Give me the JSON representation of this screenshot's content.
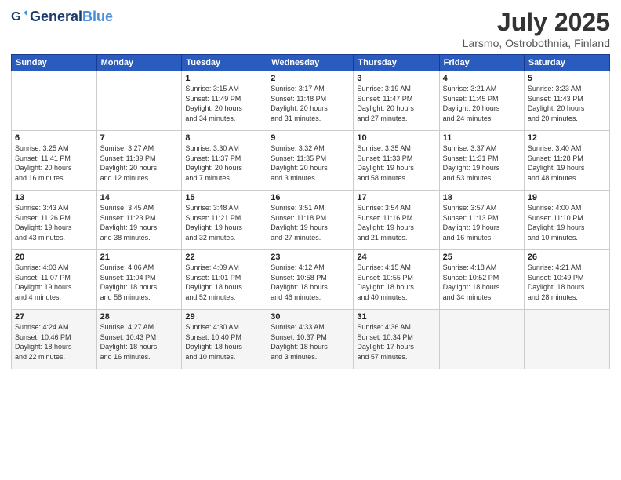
{
  "header": {
    "logo": {
      "general": "General",
      "blue": "Blue"
    },
    "title": "July 2025",
    "location": "Larsmo, Ostrobothnia, Finland"
  },
  "weekdays": [
    "Sunday",
    "Monday",
    "Tuesday",
    "Wednesday",
    "Thursday",
    "Friday",
    "Saturday"
  ],
  "weeks": [
    [
      {
        "day": "",
        "info": ""
      },
      {
        "day": "",
        "info": ""
      },
      {
        "day": "1",
        "info": "Sunrise: 3:15 AM\nSunset: 11:49 PM\nDaylight: 20 hours\nand 34 minutes."
      },
      {
        "day": "2",
        "info": "Sunrise: 3:17 AM\nSunset: 11:48 PM\nDaylight: 20 hours\nand 31 minutes."
      },
      {
        "day": "3",
        "info": "Sunrise: 3:19 AM\nSunset: 11:47 PM\nDaylight: 20 hours\nand 27 minutes."
      },
      {
        "day": "4",
        "info": "Sunrise: 3:21 AM\nSunset: 11:45 PM\nDaylight: 20 hours\nand 24 minutes."
      },
      {
        "day": "5",
        "info": "Sunrise: 3:23 AM\nSunset: 11:43 PM\nDaylight: 20 hours\nand 20 minutes."
      }
    ],
    [
      {
        "day": "6",
        "info": "Sunrise: 3:25 AM\nSunset: 11:41 PM\nDaylight: 20 hours\nand 16 minutes."
      },
      {
        "day": "7",
        "info": "Sunrise: 3:27 AM\nSunset: 11:39 PM\nDaylight: 20 hours\nand 12 minutes."
      },
      {
        "day": "8",
        "info": "Sunrise: 3:30 AM\nSunset: 11:37 PM\nDaylight: 20 hours\nand 7 minutes."
      },
      {
        "day": "9",
        "info": "Sunrise: 3:32 AM\nSunset: 11:35 PM\nDaylight: 20 hours\nand 3 minutes."
      },
      {
        "day": "10",
        "info": "Sunrise: 3:35 AM\nSunset: 11:33 PM\nDaylight: 19 hours\nand 58 minutes."
      },
      {
        "day": "11",
        "info": "Sunrise: 3:37 AM\nSunset: 11:31 PM\nDaylight: 19 hours\nand 53 minutes."
      },
      {
        "day": "12",
        "info": "Sunrise: 3:40 AM\nSunset: 11:28 PM\nDaylight: 19 hours\nand 48 minutes."
      }
    ],
    [
      {
        "day": "13",
        "info": "Sunrise: 3:43 AM\nSunset: 11:26 PM\nDaylight: 19 hours\nand 43 minutes."
      },
      {
        "day": "14",
        "info": "Sunrise: 3:45 AM\nSunset: 11:23 PM\nDaylight: 19 hours\nand 38 minutes."
      },
      {
        "day": "15",
        "info": "Sunrise: 3:48 AM\nSunset: 11:21 PM\nDaylight: 19 hours\nand 32 minutes."
      },
      {
        "day": "16",
        "info": "Sunrise: 3:51 AM\nSunset: 11:18 PM\nDaylight: 19 hours\nand 27 minutes."
      },
      {
        "day": "17",
        "info": "Sunrise: 3:54 AM\nSunset: 11:16 PM\nDaylight: 19 hours\nand 21 minutes."
      },
      {
        "day": "18",
        "info": "Sunrise: 3:57 AM\nSunset: 11:13 PM\nDaylight: 19 hours\nand 16 minutes."
      },
      {
        "day": "19",
        "info": "Sunrise: 4:00 AM\nSunset: 11:10 PM\nDaylight: 19 hours\nand 10 minutes."
      }
    ],
    [
      {
        "day": "20",
        "info": "Sunrise: 4:03 AM\nSunset: 11:07 PM\nDaylight: 19 hours\nand 4 minutes."
      },
      {
        "day": "21",
        "info": "Sunrise: 4:06 AM\nSunset: 11:04 PM\nDaylight: 18 hours\nand 58 minutes."
      },
      {
        "day": "22",
        "info": "Sunrise: 4:09 AM\nSunset: 11:01 PM\nDaylight: 18 hours\nand 52 minutes."
      },
      {
        "day": "23",
        "info": "Sunrise: 4:12 AM\nSunset: 10:58 PM\nDaylight: 18 hours\nand 46 minutes."
      },
      {
        "day": "24",
        "info": "Sunrise: 4:15 AM\nSunset: 10:55 PM\nDaylight: 18 hours\nand 40 minutes."
      },
      {
        "day": "25",
        "info": "Sunrise: 4:18 AM\nSunset: 10:52 PM\nDaylight: 18 hours\nand 34 minutes."
      },
      {
        "day": "26",
        "info": "Sunrise: 4:21 AM\nSunset: 10:49 PM\nDaylight: 18 hours\nand 28 minutes."
      }
    ],
    [
      {
        "day": "27",
        "info": "Sunrise: 4:24 AM\nSunset: 10:46 PM\nDaylight: 18 hours\nand 22 minutes."
      },
      {
        "day": "28",
        "info": "Sunrise: 4:27 AM\nSunset: 10:43 PM\nDaylight: 18 hours\nand 16 minutes."
      },
      {
        "day": "29",
        "info": "Sunrise: 4:30 AM\nSunset: 10:40 PM\nDaylight: 18 hours\nand 10 minutes."
      },
      {
        "day": "30",
        "info": "Sunrise: 4:33 AM\nSunset: 10:37 PM\nDaylight: 18 hours\nand 3 minutes."
      },
      {
        "day": "31",
        "info": "Sunrise: 4:36 AM\nSunset: 10:34 PM\nDaylight: 17 hours\nand 57 minutes."
      },
      {
        "day": "",
        "info": ""
      },
      {
        "day": "",
        "info": ""
      }
    ]
  ]
}
